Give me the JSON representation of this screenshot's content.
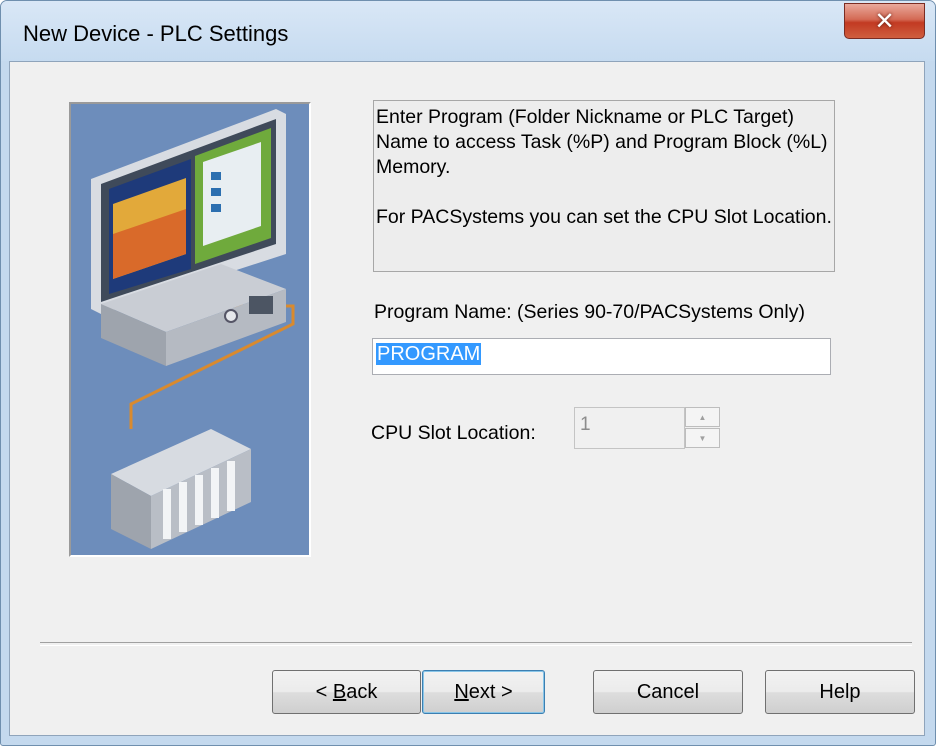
{
  "window": {
    "title": "New Device - PLC Settings",
    "close_icon": "close-icon",
    "close_glyph": "✕"
  },
  "illustration": {
    "name": "computer-plc-illustration-icon"
  },
  "description": {
    "paragraph1": "Enter Program (Folder Nickname or PLC Target) Name to access Task (%P) and Program Block (%L) Memory.",
    "paragraph2": "For PACSystems you can set the CPU Slot Location."
  },
  "program_name": {
    "label": "Program Name: (Series 90-70/PACSystems Only)",
    "value": "PROGRAM"
  },
  "cpu_slot": {
    "label": "CPU Slot Location:",
    "value": "1",
    "enabled": false,
    "up_glyph": "▲",
    "down_glyph": "▼"
  },
  "buttons": {
    "back_mnemonic": "B",
    "back_rest": "ack",
    "back_prefix": "< ",
    "next_mnemonic": "N",
    "next_rest": "ext >",
    "cancel": "Cancel",
    "help": "Help"
  },
  "colors": {
    "title_bar": "#c6dbf0",
    "close_button": "#c23a22",
    "selection": "#3399ff",
    "illustration_bg": "#6d8dbb",
    "default_button_border": "#3c7fb1"
  }
}
